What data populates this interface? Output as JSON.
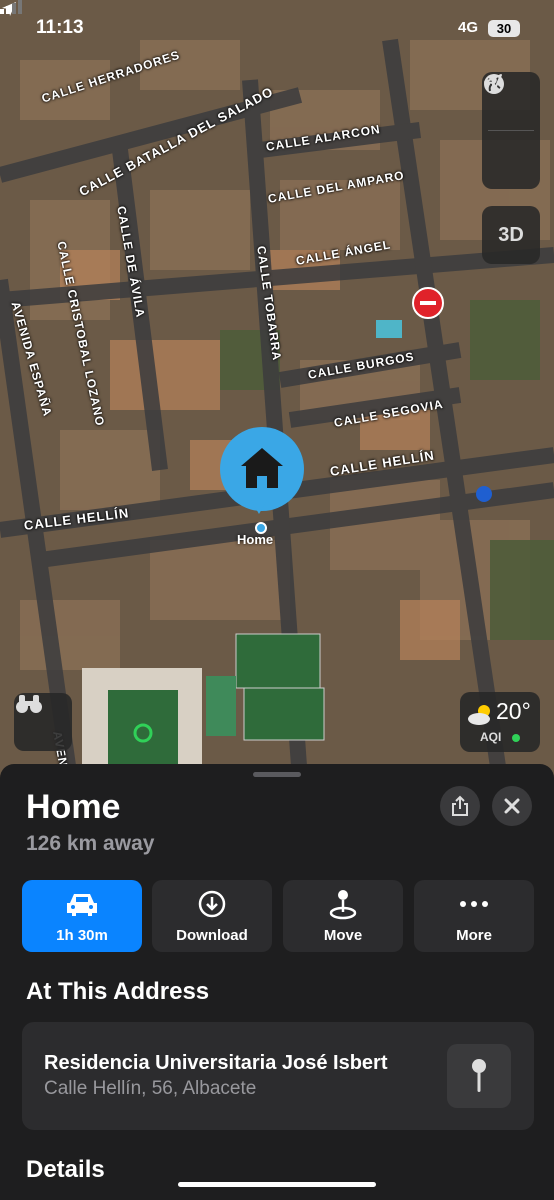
{
  "status_bar": {
    "time": "11:13",
    "network": "4G",
    "battery": "30"
  },
  "map": {
    "streets": [
      "CALLE HERRADORES",
      "CALLE BATALLA DEL SALADO",
      "CALLE ALARCON",
      "CALLE DEL AMPARO",
      "CALLE ÁNGEL",
      "CALLE DE ÁVILA",
      "CALLE CRISTOBAL LOZANO",
      "AVENIDA ESPAÑA",
      "CALLE TOBARRA",
      "CALLE BURGOS",
      "CALLE SEGOVIA",
      "CALLE HELLÍN",
      "CALLE HELLÍN",
      "AVENID"
    ],
    "pin_label": "Home",
    "controls": {
      "btn_3d": "3D"
    },
    "weather": {
      "temp": "20°",
      "aqi": "AQI",
      "aqi_color": "#30d158"
    }
  },
  "sheet": {
    "title": "Home",
    "subtitle": "126 km away",
    "actions": [
      {
        "label": "1h 30m",
        "icon": "car-icon"
      },
      {
        "label": "Download",
        "icon": "download-icon"
      },
      {
        "label": "Move",
        "icon": "move-pin-icon"
      },
      {
        "label": "More",
        "icon": "ellipsis-icon"
      }
    ],
    "section_title": "At This Address",
    "place": {
      "name": "Residencia Universitaria José Isbert",
      "address": "Calle Hellín, 56, Albacete"
    },
    "details_title": "Details"
  },
  "colors": {
    "accent": "#0a84ff",
    "pin": "#3aa7e6",
    "sheet_bg": "#1e1e1f",
    "card_bg": "#2c2c2e"
  }
}
